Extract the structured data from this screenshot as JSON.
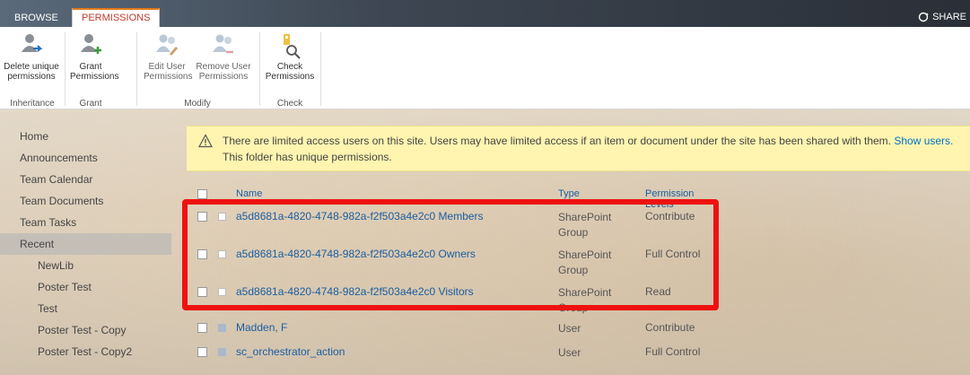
{
  "tabs": {
    "browse": "BROWSE",
    "permissions": "PERMISSIONS",
    "share": "SHARE"
  },
  "ribbon": {
    "delete_unique": [
      "Delete unique",
      "permissions"
    ],
    "grant": [
      "Grant",
      "Permissions"
    ],
    "edit_user": [
      "Edit User",
      "Permissions"
    ],
    "remove_user": [
      "Remove User",
      "Permissions"
    ],
    "check": [
      "Check",
      "Permissions"
    ],
    "groups": {
      "inheritance": "Inheritance",
      "grant": "Grant",
      "modify": "Modify",
      "check": "Check"
    }
  },
  "nav": {
    "items": [
      "Home",
      "Announcements",
      "Team Calendar",
      "Team Documents",
      "Team Tasks",
      "Recent"
    ],
    "recent": [
      "NewLib",
      "Poster Test",
      "Test",
      "Poster Test - Copy",
      "Poster Test - Copy2"
    ]
  },
  "info": {
    "message": "There are limited access users on this site. Users may have limited access if an item or document under the site has been shared with them.",
    "link": "Show users.",
    "unique": "This folder has unique permissions."
  },
  "table": {
    "headers": {
      "name": "Name",
      "type": "Type",
      "levels": "Permission Levels"
    },
    "rows": [
      {
        "name": "a5d8681a-4820-4748-982a-f2f503a4e2c0 Members",
        "type": [
          "SharePoint",
          "Group"
        ],
        "level": "Contribute"
      },
      {
        "name": "a5d8681a-4820-4748-982a-f2f503a4e2c0 Owners",
        "type": [
          "SharePoint",
          "Group"
        ],
        "level": "Full Control"
      },
      {
        "name": "a5d8681a-4820-4748-982a-f2f503a4e2c0 Visitors",
        "type": [
          "SharePoint",
          "Group"
        ],
        "level": "Read"
      },
      {
        "name": "Madden, F",
        "type": [
          "User"
        ],
        "level": "Contribute"
      },
      {
        "name": "sc_orchestrator_action",
        "type": [
          "User"
        ],
        "level": "Full Control"
      }
    ]
  },
  "colors": {
    "accent": "#e37a1b",
    "link": "#1a5ea1",
    "highlight": "#ee1111",
    "infobar": "#fff5b0"
  }
}
